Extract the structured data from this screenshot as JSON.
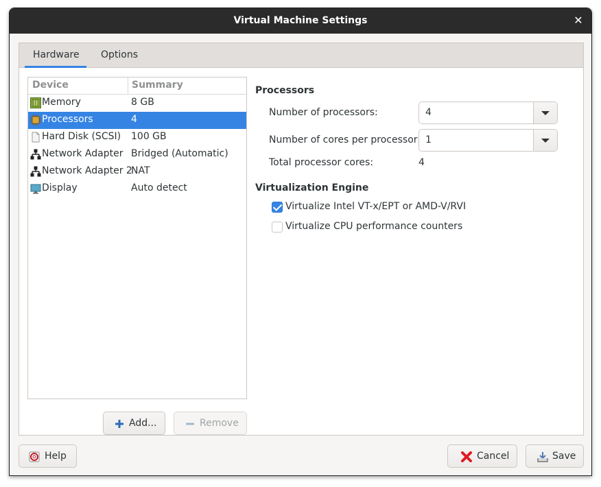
{
  "window": {
    "title": "Virtual Machine Settings"
  },
  "tabs": [
    {
      "label": "Hardware",
      "active": true
    },
    {
      "label": "Options",
      "active": false
    }
  ],
  "device_list": {
    "headers": {
      "device": "Device",
      "summary": "Summary"
    },
    "rows": [
      {
        "icon": "memory-icon",
        "name": "Memory",
        "summary": "8 GB",
        "selected": false
      },
      {
        "icon": "processor-icon",
        "name": "Processors",
        "summary": "4",
        "selected": true
      },
      {
        "icon": "hard-disk-icon",
        "name": "Hard Disk (SCSI)",
        "summary": "100 GB",
        "selected": false
      },
      {
        "icon": "network-icon",
        "name": "Network Adapter",
        "summary": "Bridged (Automatic)",
        "selected": false
      },
      {
        "icon": "network-icon",
        "name": "Network Adapter 2",
        "summary": "NAT",
        "selected": false
      },
      {
        "icon": "display-icon",
        "name": "Display",
        "summary": "Auto detect",
        "selected": false
      }
    ]
  },
  "buttons": {
    "add": "Add...",
    "remove": "Remove",
    "help": "Help",
    "cancel": "Cancel",
    "save": "Save"
  },
  "processors": {
    "title": "Processors",
    "num_processors_label": "Number of processors:",
    "num_processors_value": "4",
    "cores_label": "Number of cores per processor:",
    "cores_value": "1",
    "total_label": "Total processor cores:",
    "total_value": "4"
  },
  "virtualization": {
    "title": "Virtualization Engine",
    "vtx_label": "Virtualize Intel VT-x/EPT or AMD-V/RVI",
    "vtx_checked": true,
    "perf_label": "Virtualize CPU performance counters",
    "perf_checked": false
  },
  "colors": {
    "accent": "#3584e4",
    "titlebar": "#2b2b2b",
    "cancel_icon": "#e01b24"
  }
}
